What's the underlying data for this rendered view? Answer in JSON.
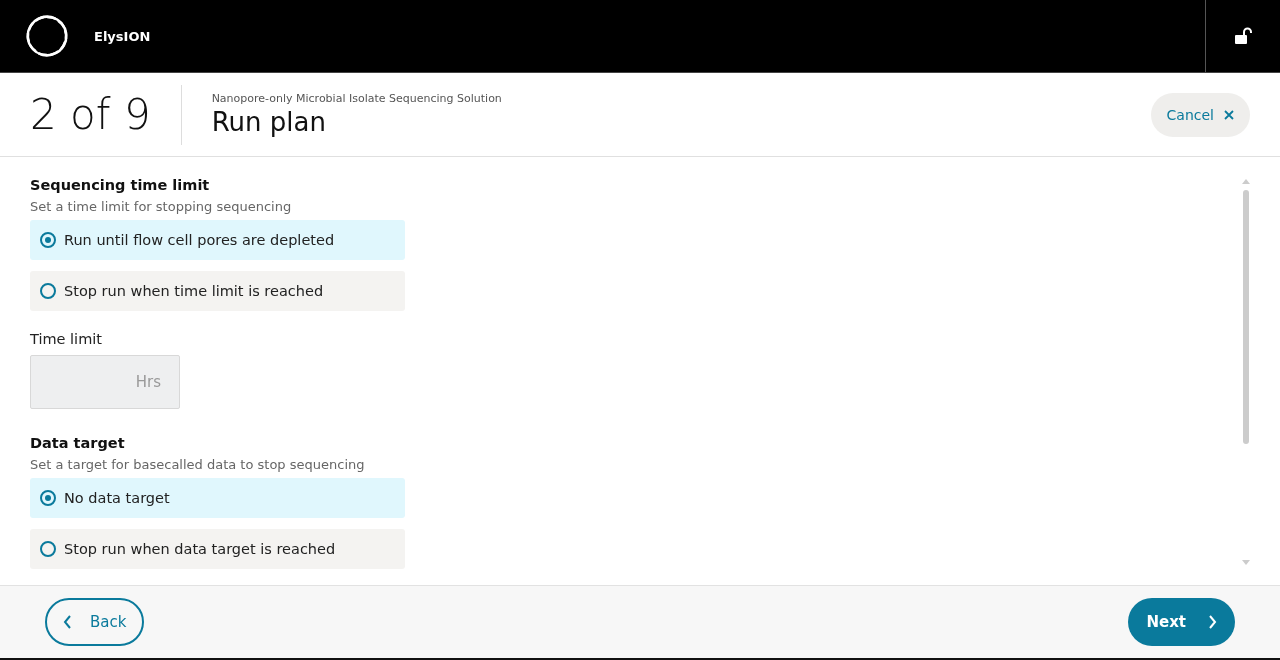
{
  "app": {
    "name": "ElysION",
    "locked": false
  },
  "step": {
    "counter": "2 of 9",
    "subtitle": "Nanopore-only Microbial Isolate Sequencing Solution",
    "title": "Run plan",
    "cancel": "Cancel"
  },
  "sections": [
    {
      "kind": "radio",
      "title": "Sequencing time limit",
      "description": "Set a time limit for stopping sequencing",
      "options": [
        {
          "label": "Run until flow cell pores are depleted",
          "selected": true
        },
        {
          "label": "Stop run when time limit is reached",
          "selected": false
        }
      ]
    },
    {
      "kind": "field",
      "label": "Time limit",
      "placeholder": "Hrs",
      "disabled": true
    },
    {
      "kind": "radio",
      "title": "Data target",
      "description": "Set a target for basecalled data to stop sequencing",
      "options": [
        {
          "label": "No data target",
          "selected": true
        },
        {
          "label": "Stop run when data target is reached",
          "selected": false
        }
      ]
    }
  ],
  "footer": {
    "back": "Back",
    "next": "Next"
  }
}
